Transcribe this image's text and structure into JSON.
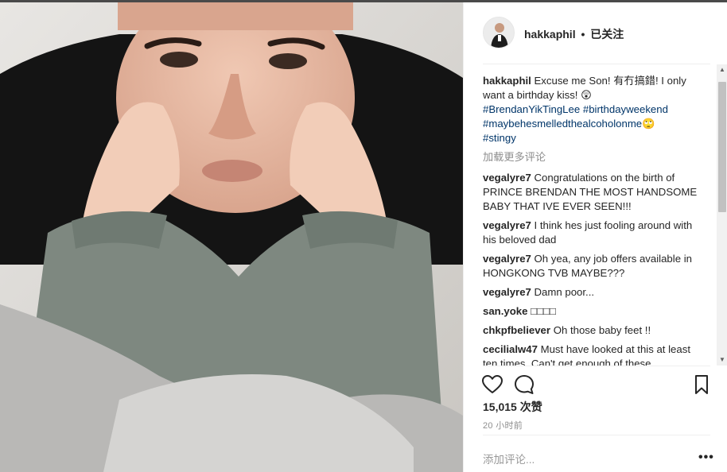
{
  "post": {
    "username": "hakkaphil",
    "separator": "•",
    "follow_status": "已关注",
    "caption_user": "hakkaphil",
    "caption_text": "Excuse me Son! 有冇搞錯! I only want a birthday kiss! 😲",
    "hashtags": [
      "#BrendanYikTingLee",
      "#birthdayweekend",
      "#maybehesmelledthealcoholonme🙄",
      "#stingy"
    ],
    "load_more": "加载更多评论",
    "likes": "15,015 次赞",
    "time": "20 小时前",
    "add_comment_placeholder": "添加评论...",
    "more_options": "•••"
  },
  "comments": [
    {
      "user": "vegalyre7",
      "text": "Congratulations on the birth of PRINCE BRENDAN THE MOST HANDSOME BABY THAT IVE EVER SEEN!!!"
    },
    {
      "user": "vegalyre7",
      "text": "I think hes just fooling around with his beloved dad"
    },
    {
      "user": "vegalyre7",
      "text": "Oh yea, any job offers available in HONGKONG TVB MAYBE???"
    },
    {
      "user": "vegalyre7",
      "text": "Damn poor..."
    },
    {
      "user": "san.yoke",
      "text": "□□□□"
    },
    {
      "user": "chkpfbeliever",
      "text": "Oh those baby feet !!"
    },
    {
      "user": "cecilialw47",
      "text": "Must have looked at this at least ten times. Can't get enough of these"
    }
  ],
  "icons": {
    "like": "heart-icon",
    "comment": "comment-bubble-icon",
    "save": "bookmark-icon",
    "scroll_up": "triangle-up-icon",
    "scroll_down": "triangle-down-icon"
  },
  "colors": {
    "hashtag": "#003569",
    "muted": "#8e8e8e",
    "text": "#262626"
  }
}
